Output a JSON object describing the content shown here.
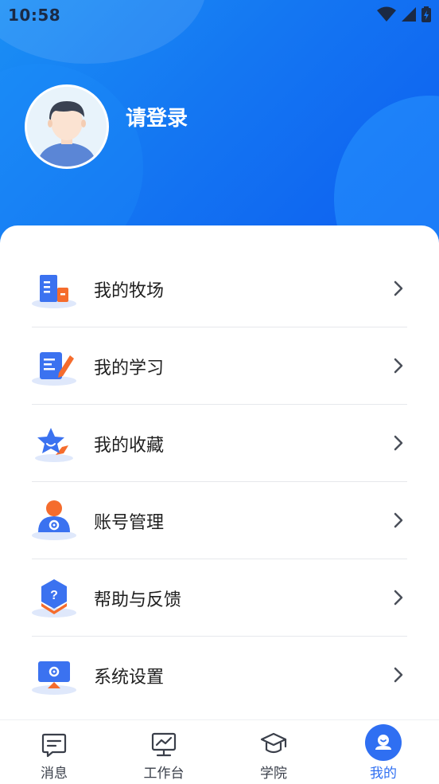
{
  "status_bar": {
    "time": "10:58"
  },
  "profile": {
    "login_text": "请登录"
  },
  "menu": [
    {
      "label": "我的牧场",
      "icon": "farm-building-icon"
    },
    {
      "label": "我的学习",
      "icon": "study-notebook-icon"
    },
    {
      "label": "我的收藏",
      "icon": "star-favorite-icon"
    },
    {
      "label": "账号管理",
      "icon": "account-settings-icon"
    },
    {
      "label": "帮助与反馈",
      "icon": "help-feedback-icon"
    },
    {
      "label": "系统设置",
      "icon": "system-settings-icon"
    }
  ],
  "tabbar": {
    "items": [
      {
        "label": "消息",
        "icon": "message-icon",
        "active": false
      },
      {
        "label": "工作台",
        "icon": "workbench-icon",
        "active": false
      },
      {
        "label": "学院",
        "icon": "academy-icon",
        "active": false
      },
      {
        "label": "我的",
        "icon": "profile-icon",
        "active": true
      }
    ]
  },
  "colors": {
    "accent": "#2f6ff2",
    "header_blue": "#1476f2",
    "icon_orange": "#f56c2d"
  }
}
